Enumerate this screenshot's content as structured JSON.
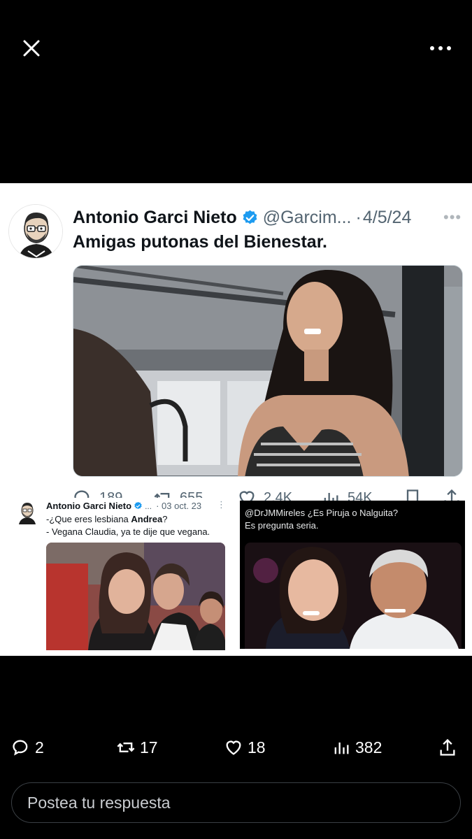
{
  "header": {
    "close_icon": "close-icon",
    "more_icon": "more-options-icon"
  },
  "tweet": {
    "name": "Antonio Garci Nieto",
    "handle": "@Garcim...",
    "date": "4/5/24",
    "text": "Amigas putonas del Bienestar.",
    "counts": {
      "replies": "189",
      "retweets": "655",
      "likes": "2.4K",
      "views": "54K"
    }
  },
  "collage": {
    "left": {
      "name": "Antonio Garci Nieto",
      "handle": "...",
      "date": "03 oct. 23",
      "line1_pre": "-¿Que eres lesbiana ",
      "line1_bold": "Andrea",
      "line1_post": "?",
      "line2": "- Vegana Claudia, ya te dije que vegana."
    },
    "right": {
      "line1": "@DrJMMireles  ¿Es Piruja o Nalguita?",
      "line2": "Es pregunta seria."
    }
  },
  "actions": {
    "replies": "2",
    "reposts": "17",
    "likes": "18",
    "views": "382"
  },
  "reply": {
    "placeholder": "Postea tu respuesta"
  },
  "colors": {
    "background": "#000000",
    "verified": "#1d9bf0",
    "secondary_text": "#536471"
  }
}
